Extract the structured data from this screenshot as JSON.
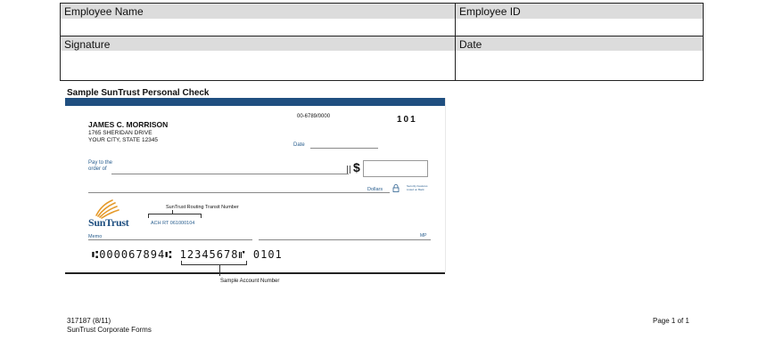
{
  "form": {
    "employee_name_label": "Employee Name",
    "employee_id_label": "Employee ID",
    "signature_label": "Signature",
    "date_label": "Date"
  },
  "section_title": "Sample SunTrust Personal Check",
  "check": {
    "owner_name": "JAMES C. MORRISON",
    "address_line1": "1765 SHERIDAN DRIVE",
    "address_line2": "YOUR CITY, STATE  12345",
    "fraction_code": "00-6789/0000",
    "check_number": "101",
    "date_label": "Date",
    "pay_to_line1": "Pay to the",
    "pay_to_line2": "order of",
    "dollar_sign": "$",
    "dollars_label": "Dollars",
    "security_text": "Security Features Listed on Back",
    "routing_label": "SunTrust Routing Transit Number",
    "ach_text": "ACH RT 061000104",
    "logo_text": "SunTrust",
    "memo_label": "Memo",
    "mp_text": "MP",
    "micr_line": "⑆000067894⑆ 12345678⑈ 0101",
    "account_label": "Sample Account Number"
  },
  "footer": {
    "form_number": "317187 (8/11)",
    "form_name": "SunTrust Corporate Forms",
    "page": "Page 1 of 1"
  },
  "colors": {
    "check_bar": "#1f4f80",
    "label_bg": "#dcdcdc",
    "check_text_blue": "#2a5f8f"
  }
}
